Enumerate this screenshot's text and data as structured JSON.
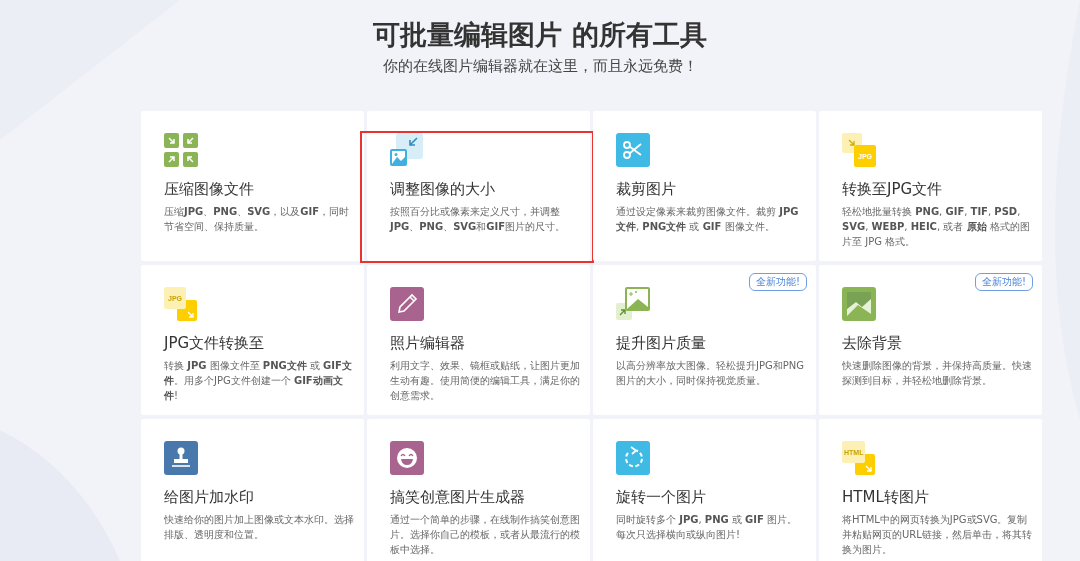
{
  "heading": {
    "title": "可批量编辑图片 的所有工具",
    "subtitle": "你的在线图片编辑器就在这里，而且永远免费！"
  },
  "cards": [
    {
      "kind": "compress",
      "title": "压缩图像文件",
      "description": "压缩**JPG**、**PNG**、**SVG**，以及**GIF**，同时节省空间、保持质量。",
      "highlighted": false
    },
    {
      "kind": "resize",
      "title": "调整图像的大小",
      "description": "按照百分比或像素来定义尺寸，并调整**JPG**、**PNG**、**SVG**和**GIF**图片的尺寸。",
      "highlighted": true
    },
    {
      "kind": "crop",
      "title": "裁剪图片",
      "description": "通过设定像素来裁剪图像文件。裁剪 **JPG文件**, **PNG文件** 或 **GIF** 图像文件。",
      "highlighted": false
    },
    {
      "kind": "to-format",
      "icon_label": "JPG",
      "title": "转换至JPG文件",
      "description": "轻松地批量转换 **PNG**, **GIF**, **TIF**, **PSD**, **SVG**, **WEBP**, **HEIC**, 或者 **原始** 格式的图片至 JPG 格式。",
      "highlighted": false
    },
    {
      "kind": "from-format",
      "icon_label": "JPG",
      "title": "JPG文件转换至",
      "description": "转换 **JPG** 图像文件至 **PNG文件** 或 **GIF文件**。用多个JPG文件创建一个 **GIF动画文件**!",
      "highlighted": false
    },
    {
      "kind": "edit",
      "title": "照片编辑器",
      "description": "利用文字、效果、镜框或贴纸，让图片更加生动有趣。使用简便的编辑工具，满足你的创意需求。",
      "highlighted": false
    },
    {
      "kind": "upscale",
      "title": "提升图片质量",
      "description": "以高分辨率放大图像。轻松提升JPG和PNG图片的大小，同时保持视觉质量。",
      "badge": "全新功能!",
      "highlighted": false
    },
    {
      "kind": "remove-bg",
      "title": "去除背景",
      "description": "快速删除图像的背景，并保持高质量。快速探测到目标，并轻松地删除背景。",
      "badge": "全新功能!",
      "highlighted": false
    },
    {
      "kind": "watermark",
      "title": "给图片加水印",
      "description": "快速给你的图片加上图像或文本水印。选择排版、透明度和位置。",
      "highlighted": false
    },
    {
      "kind": "meme",
      "title": "搞笑创意图片生成器",
      "description": "通过一个简单的步骤，在线制作搞笑创意图片。选择你自己的模板，或者从最流行的模板中选择。",
      "highlighted": false
    },
    {
      "kind": "rotate",
      "title": "旋转一个图片",
      "description": "同时旋转多个 **JPG**, **PNG** 或 **GIF** 图片。每次只选择横向或纵向图片!",
      "highlighted": false
    },
    {
      "kind": "from-format",
      "icon_label": "HTML",
      "title": "HTML转图片",
      "description": "将HTML中的网页转换为JPG或SVG。复制并粘贴网页的URL链接，然后单击，将其转换为图片。",
      "highlighted": false
    }
  ]
}
